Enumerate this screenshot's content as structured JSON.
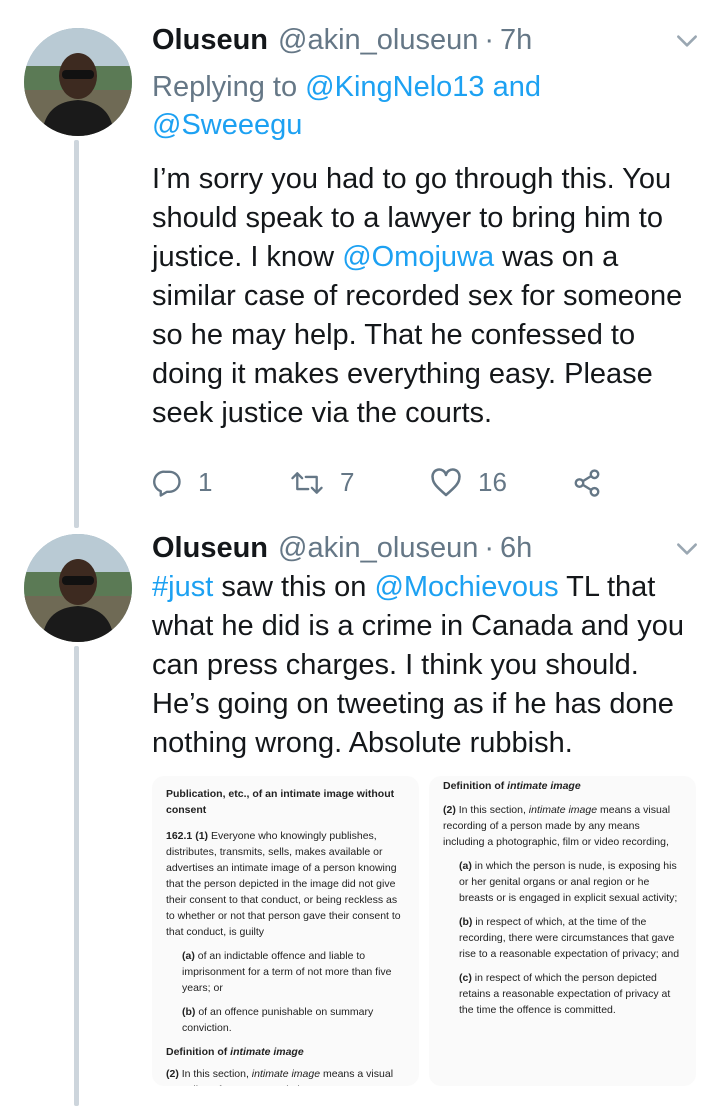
{
  "tweets": [
    {
      "name": "Oluseun",
      "handle": "@akin_oluseun",
      "separator": "·",
      "time": "7h",
      "reply_prefix": "Replying to",
      "reply_user1": "@KingNelo13",
      "reply_and": "and",
      "reply_user2": "@Sweeegu",
      "body_part1": "I’m sorry you had to go through this. You should speak to a lawyer to bring him to justice. I know ",
      "body_mention": "@Omojuwa",
      "body_part2": " was on a similar case of recorded sex for someone so he may help. That he confessed to doing it makes everything easy. Please seek justice via the courts.",
      "replies": "1",
      "retweets": "7",
      "likes": "16"
    },
    {
      "name": "Oluseun",
      "handle": "@akin_oluseun",
      "separator": "·",
      "time": "6h",
      "body_hashtag": "#just",
      "body_part1": " saw this on ",
      "body_mention": "@Mochievous",
      "body_part2": " TL that what he did is a crime in Canada and you can press charges. I think you should. He’s going on tweeting as if he has done nothing wrong. Absolute rubbish."
    }
  ],
  "attachment": {
    "left": {
      "heading": "Publication, etc., of an intimate image without consent",
      "section_num": "162.1 (1)",
      "section_text": " Everyone who knowingly publishes, distributes, transmits, sells, makes available or advertises an intimate image of a person knowing that the person depicted in the image did not give their consent to that conduct, or being reckless as to whether or not that person gave their consent to that conduct, is guilty",
      "a_label": "(a)",
      "a_text": " of an indictable offence and liable to imprisonment for a term of not more than five years; or",
      "b_label": "(b)",
      "b_text": " of an offence punishable on summary conviction.",
      "def_heading_prefix": "Definition of ",
      "def_heading_term": "intimate image",
      "def_num": "(2)",
      "def_text_prefix": " In this section, ",
      "def_text_term": "intimate image",
      "def_text_rest": " means a visual recording of a person made by any means including a photographic, film or video"
    },
    "right": {
      "def_heading_prefix": "Definition of ",
      "def_heading_term": "intimate image",
      "def_num": "(2)",
      "def_text_prefix": " In this section, ",
      "def_text_term": "intimate image",
      "def_text_rest": " means a visual recording of a person made by any means including a photographic, film or video recording,",
      "a_label": "(a)",
      "a_text": " in which the person is nude, is exposing his or her genital organs or anal region or he breasts or is engaged in explicit sexual activity;",
      "b_label": "(b)",
      "b_text": " in respect of which, at the time of the recording, there were circumstances that gave rise to a reasonable expectation of privacy; and",
      "c_label": "(c)",
      "c_text": " in respect of which the person depicted retains a reasonable expectation of privacy at the time the offence is committed."
    }
  },
  "colors": {
    "link": "#1da1f2",
    "muted": "#657786",
    "text": "#14171a",
    "thread_line": "#cdd5dc"
  },
  "icons": [
    "chevron-down-icon",
    "reply-icon",
    "retweet-icon",
    "like-icon",
    "share-icon"
  ]
}
